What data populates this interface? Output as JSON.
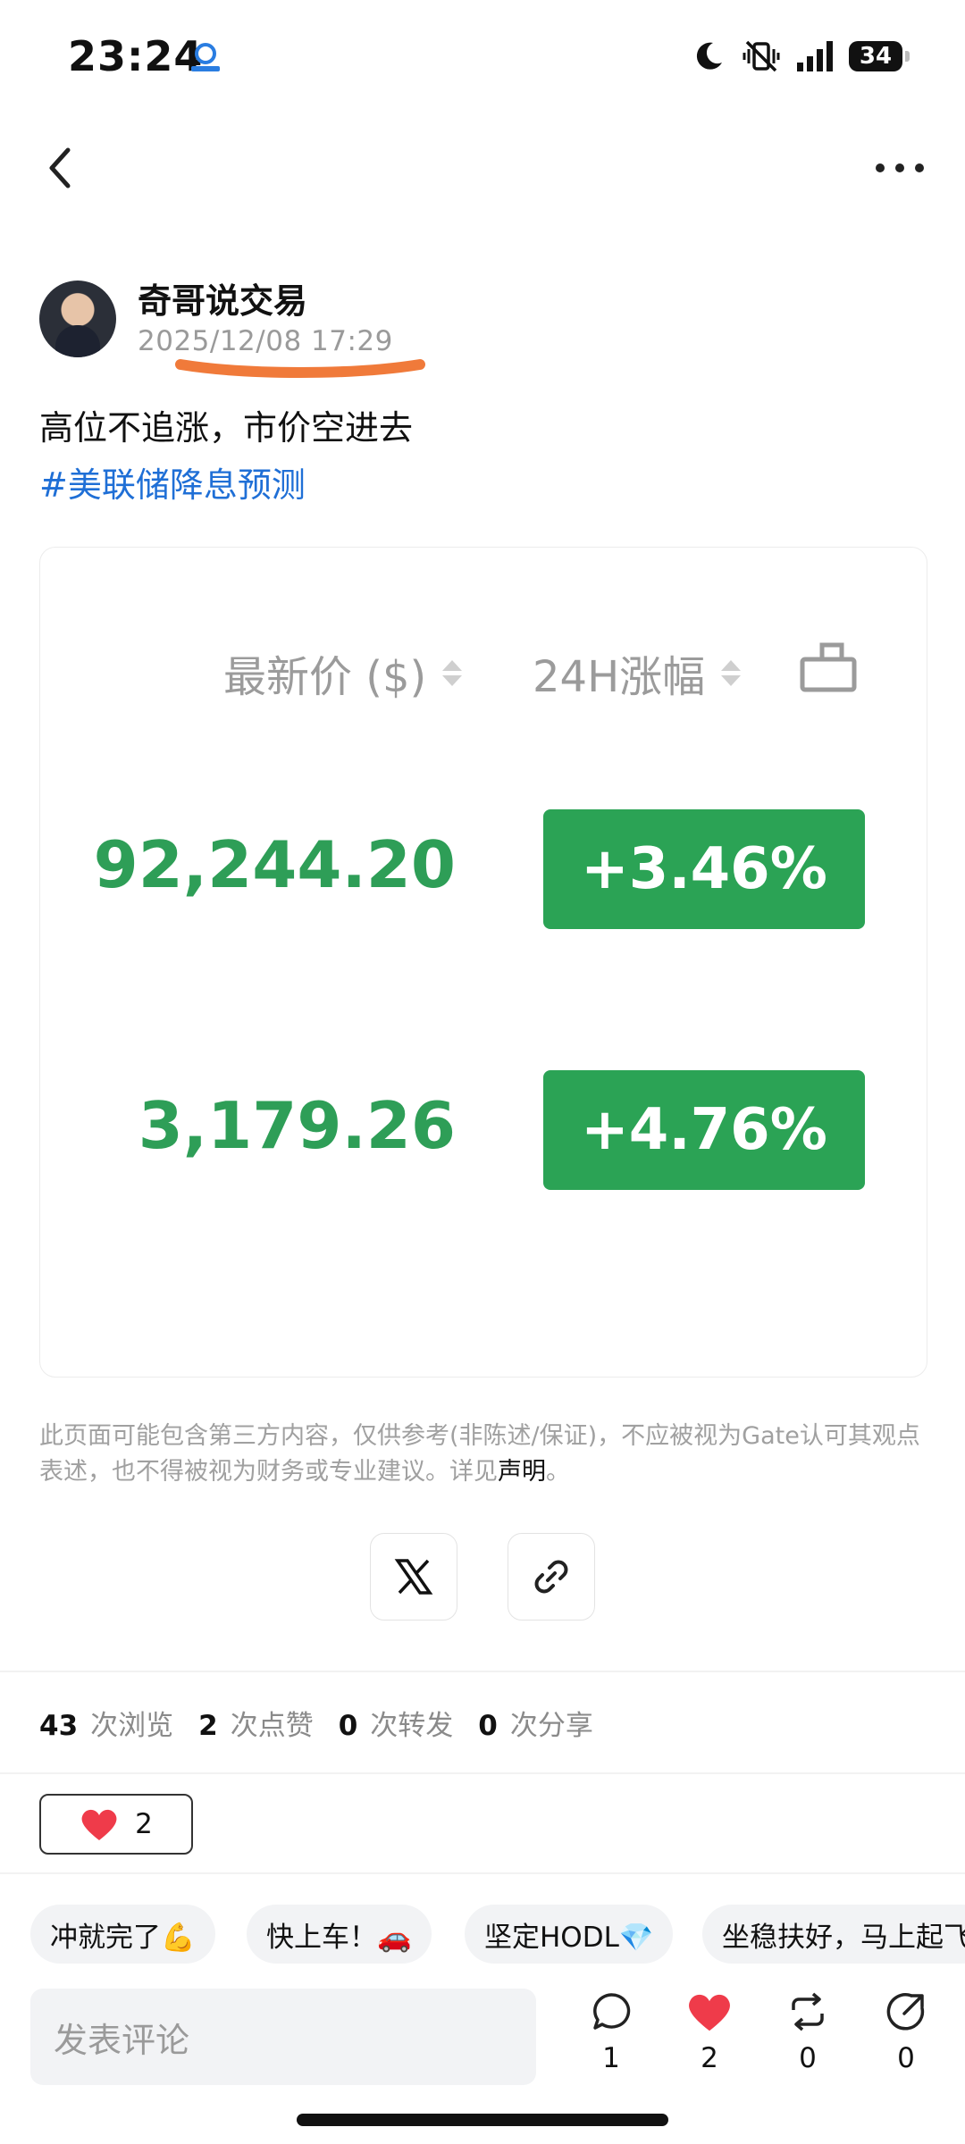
{
  "status_bar": {
    "time": "23:24",
    "battery": "34"
  },
  "author": {
    "name": "奇哥说交易",
    "timestamp": "2025/12/08 17:29"
  },
  "post": {
    "text": "高位不追涨，市价空进去",
    "hashtag": "#美联储降息预测"
  },
  "card": {
    "col_price": "最新价 ($)",
    "col_change": "24H涨幅",
    "rows": [
      {
        "price": "92,244.20",
        "change": "+3.46%"
      },
      {
        "price": "3,179.26",
        "change": "+4.76%"
      }
    ],
    "price_color": "#2e9e57",
    "change_color": "#2ba355"
  },
  "disclaimer": {
    "text": "此页面可能包含第三方内容，仅供参考(非陈述/保证)，不应被视为Gate认可其观点表述，也不得被视为财务或专业建议。详见",
    "link": "声明",
    "end": "。"
  },
  "stats": [
    {
      "count": "43",
      "label": "次浏览"
    },
    {
      "count": "2",
      "label": "次点赞"
    },
    {
      "count": "0",
      "label": "次转发"
    },
    {
      "count": "0",
      "label": "次分享"
    }
  ],
  "reaction": {
    "icon": "heart-icon",
    "count": "2"
  },
  "quick_replies": [
    "冲就完了💪",
    "快上车！🚗",
    "坚定HODL💎",
    "坐稳扶好，马上起飞"
  ],
  "comment": {
    "placeholder": "发表评论"
  },
  "actions": {
    "comment_count": "1",
    "like_count": "2",
    "repost_count": "0",
    "share_count": "0"
  },
  "accent_colors": {
    "hashtag": "#1f6fd6",
    "heart": "#ef3b4a"
  }
}
